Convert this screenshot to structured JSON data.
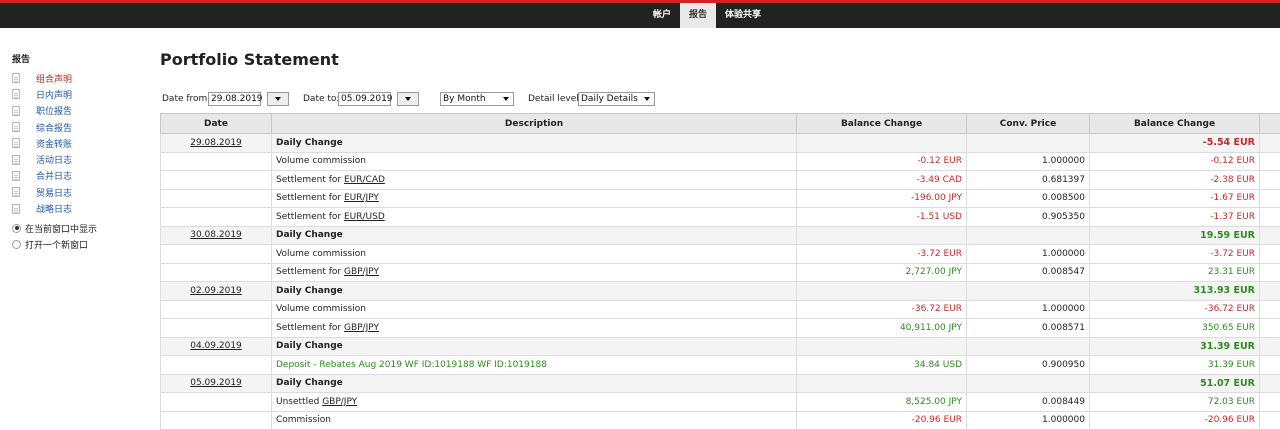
{
  "topnav": {
    "items": [
      {
        "label": "帐户",
        "active": false
      },
      {
        "label": "报告",
        "active": true
      },
      {
        "label": "体验共享",
        "active": false
      }
    ]
  },
  "sidebar": {
    "title": "报告",
    "items": [
      {
        "label": "组合声明",
        "active": true
      },
      {
        "label": "日内声明",
        "active": false
      },
      {
        "label": "职位报告",
        "active": false
      },
      {
        "label": "综合报告",
        "active": false
      },
      {
        "label": "资金转账",
        "active": false
      },
      {
        "label": "活动日志",
        "active": false
      },
      {
        "label": "合并日志",
        "active": false
      },
      {
        "label": "贸易日志",
        "active": false
      },
      {
        "label": "战略日志",
        "active": false
      }
    ],
    "window_options": [
      {
        "label": "在当前窗口中显示",
        "checked": true
      },
      {
        "label": "打开一个新窗口",
        "checked": false
      }
    ]
  },
  "page_title": "Portfolio Statement",
  "filters": {
    "date_from_label": "Date from:",
    "date_from_value": "29.08.2019",
    "date_to_label": "Date to:",
    "date_to_value": "05.09.2019",
    "period_value": "By Month",
    "detail_label": "Detail level:",
    "detail_value": "Daily Details"
  },
  "table": {
    "headers": [
      "Date",
      "Description",
      "Balance Change",
      "Conv. Price",
      "Balance Change",
      ""
    ],
    "groups": [
      {
        "date": "29.08.2019",
        "label": "Daily Change",
        "total": "-5.54 EUR",
        "sign": "neg",
        "rows": [
          {
            "pre": "Volume commission",
            "link": "",
            "post": "",
            "bal": "-0.12 EUR",
            "bal_sign": "neg",
            "conv": "1.000000",
            "eur": "-0.12 EUR",
            "eur_sign": "neg"
          },
          {
            "pre": "Settlement for ",
            "link": "EUR/CAD",
            "post": "",
            "bal": "-3.49 CAD",
            "bal_sign": "neg",
            "conv": "0.681397",
            "eur": "-2.38 EUR",
            "eur_sign": "neg"
          },
          {
            "pre": "Settlement for ",
            "link": "EUR/JPY",
            "post": "",
            "bal": "-196.00 JPY",
            "bal_sign": "neg",
            "conv": "0.008500",
            "eur": "-1.67 EUR",
            "eur_sign": "neg"
          },
          {
            "pre": "Settlement for ",
            "link": "EUR/USD",
            "post": "",
            "bal": "-1.51 USD",
            "bal_sign": "neg",
            "conv": "0.905350",
            "eur": "-1.37 EUR",
            "eur_sign": "neg"
          }
        ]
      },
      {
        "date": "30.08.2019",
        "label": "Daily Change",
        "total": "19.59 EUR",
        "sign": "pos",
        "rows": [
          {
            "pre": "Volume commission",
            "link": "",
            "post": "",
            "bal": "-3.72 EUR",
            "bal_sign": "neg",
            "conv": "1.000000",
            "eur": "-3.72 EUR",
            "eur_sign": "neg"
          },
          {
            "pre": "Settlement for ",
            "link": "GBP/JPY",
            "post": "",
            "bal": "2,727.00 JPY",
            "bal_sign": "pos",
            "conv": "0.008547",
            "eur": "23.31 EUR",
            "eur_sign": "pos"
          }
        ]
      },
      {
        "date": "02.09.2019",
        "label": "Daily Change",
        "total": "313.93 EUR",
        "sign": "pos",
        "rows": [
          {
            "pre": "Volume commission",
            "link": "",
            "post": "",
            "bal": "-36.72 EUR",
            "bal_sign": "neg",
            "conv": "1.000000",
            "eur": "-36.72 EUR",
            "eur_sign": "neg"
          },
          {
            "pre": "Settlement for ",
            "link": "GBP/JPY",
            "post": "",
            "bal": "40,911.00 JPY",
            "bal_sign": "pos",
            "conv": "0.008571",
            "eur": "350.65 EUR",
            "eur_sign": "pos"
          }
        ]
      },
      {
        "date": "04.09.2019",
        "label": "Daily Change",
        "total": "31.39 EUR",
        "sign": "pos",
        "rows": [
          {
            "pre": "Deposit - Rebates Aug 2019 WF ID:1019188 WF ID:1019188",
            "link": "",
            "post": "",
            "green": true,
            "bal": "34.84 USD",
            "bal_sign": "pos",
            "conv": "0.900950",
            "eur": "31.39 EUR",
            "eur_sign": "pos"
          }
        ]
      },
      {
        "date": "05.09.2019",
        "label": "Daily Change",
        "total": "51.07 EUR",
        "sign": "pos",
        "rows": [
          {
            "pre": "Unsettled ",
            "link": "GBP/JPY",
            "post": "",
            "bal": "8,525.00 JPY",
            "bal_sign": "pos",
            "conv": "0.008449",
            "eur": "72.03 EUR",
            "eur_sign": "pos"
          },
          {
            "pre": "Commission",
            "link": "",
            "post": "",
            "bal": "-20.96 EUR",
            "bal_sign": "neg",
            "conv": "1.000000",
            "eur": "-20.96 EUR",
            "eur_sign": "neg"
          }
        ]
      }
    ]
  }
}
